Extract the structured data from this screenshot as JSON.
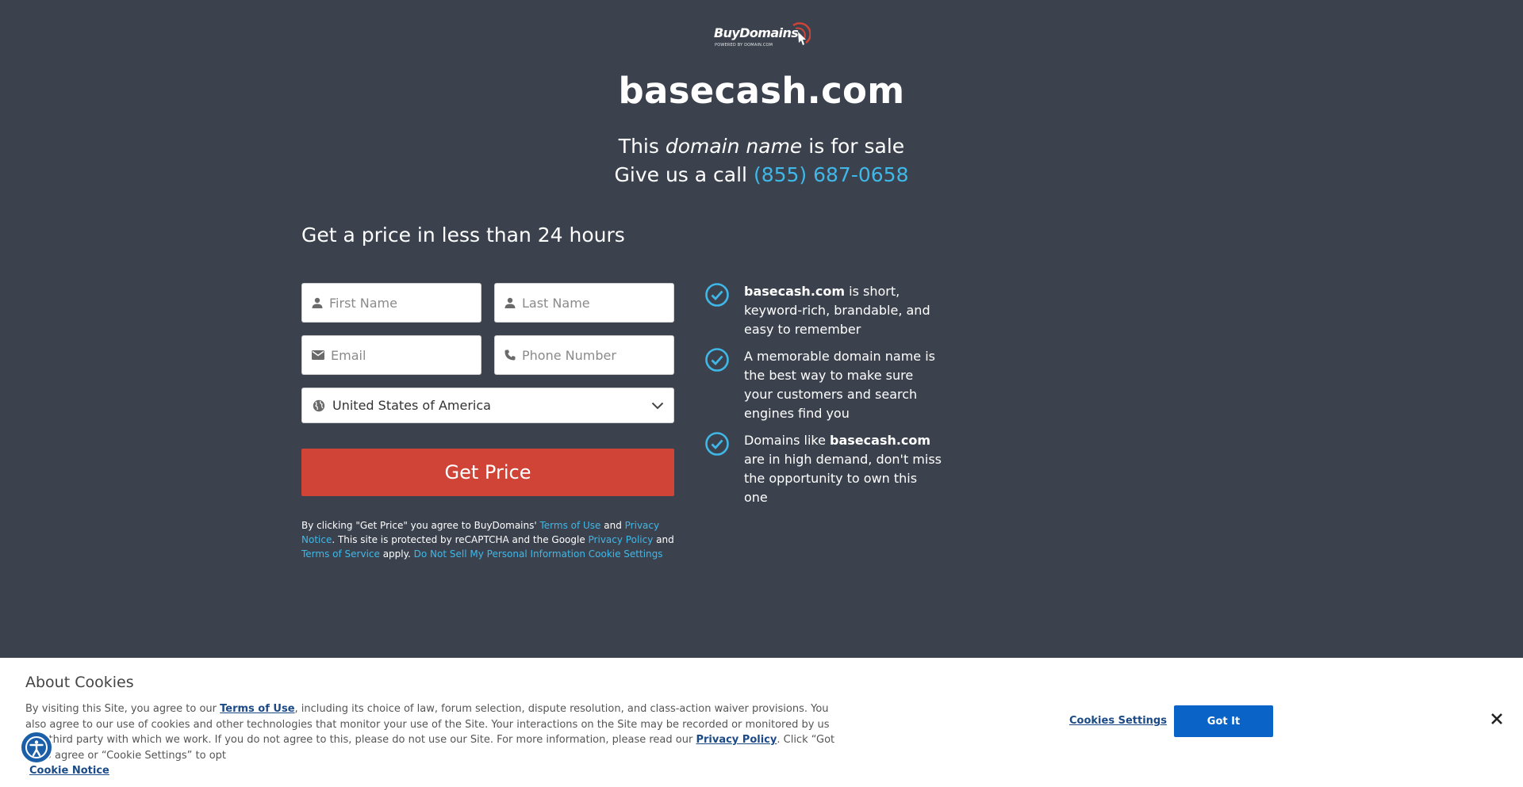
{
  "logo": {
    "brand": "BuyDomains",
    "tagline": "POWERED BY DOMAIN.COM"
  },
  "domain": "basecash.com",
  "sale": {
    "prefix": "This ",
    "emphasis": "domain name",
    "suffix": " is for sale"
  },
  "call": {
    "prefix": "Give us a call ",
    "phone": "(855) 687-0658"
  },
  "form": {
    "heading": "Get a price in less than 24 hours",
    "first_name_placeholder": "First Name",
    "last_name_placeholder": "Last Name",
    "email_placeholder": "Email",
    "phone_placeholder": "Phone Number",
    "country_value": "United States of America",
    "submit_label": "Get Price"
  },
  "legal": {
    "p1": "By clicking \"Get Price\" you agree to BuyDomains' ",
    "terms_of_use": "Terms of Use",
    "and1": " and ",
    "privacy_notice": "Privacy Notice",
    "p2": ". This site is protected by reCAPTCHA and the Google ",
    "privacy_policy": "Privacy Policy",
    "and2": " and ",
    "terms_of_service": "Terms of Service",
    "p3": " apply. ",
    "do_not_sell": "Do Not Sell My Personal Information",
    "cookie_settings": "Cookie Settings"
  },
  "benefits": [
    {
      "bold": "basecash.com",
      "text": " is short, keyword-rich, brandable, and easy to remember"
    },
    {
      "text": "A memorable domain name is the best way to make sure your customers and search engines find you"
    },
    {
      "pre": "Domains like ",
      "bold": "basecash.com",
      "text": " are in high demand, don't miss the opportunity to own this one"
    }
  ],
  "cookie_banner": {
    "title": "About Cookies",
    "t1": "By visiting this Site, you agree to our ",
    "terms_link": "Terms of Use",
    "t2": ", including its choice of law, forum selection, dispute resolution, and class-action waiver provisions. You also agree to our use of cookies and other technologies that monitor your use of the Site. Your interactions on the Site may be recorded or monitored by us or a third party with which we work. If you do not agree to this, please do not use our Site. For more information, please read our ",
    "privacy_link": "Privacy Policy",
    "t3": ". Click “Got It” to agree or “Cookie Settings” to opt",
    "cookie_notice": "Cookie Notice",
    "settings_label": "Cookies Settings",
    "got_it_label": "Got It"
  },
  "colors": {
    "background": "#3b424e",
    "accent_link": "#3fb8e8",
    "cta": "#d04437",
    "banner_button": "#0a64c8"
  }
}
